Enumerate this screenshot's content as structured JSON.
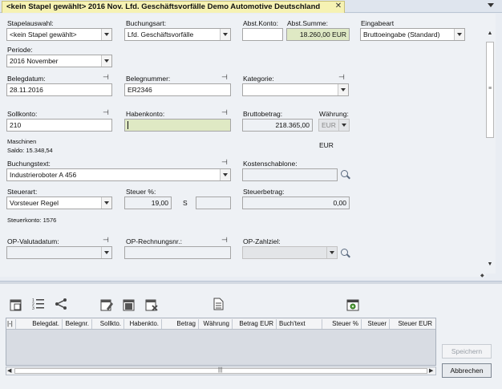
{
  "tab": {
    "title": "<kein Stapel gewählt> 2016 Nov. Lfd. Geschäftsvorfälle Demo Automotive Deutschland",
    "close": "✕"
  },
  "form": {
    "stapelauswahl": {
      "label": "Stapelauswahl:",
      "value": "<kein Stapel gewählt>"
    },
    "buchungsart": {
      "label": "Buchungsart:",
      "value": "Lfd. Geschäftsvorfälle"
    },
    "abst_konto": {
      "label": "Abst.Konto:",
      "value": ""
    },
    "abst_summe": {
      "label": "Abst.Summe:",
      "value": "18.260,00 EUR"
    },
    "eingabeart": {
      "label": "Eingabeart",
      "value": "Bruttoeingabe (Standard)"
    },
    "periode": {
      "label": "Periode:",
      "value": "2016  November"
    },
    "belegdatum": {
      "label": "Belegdatum:",
      "value": "28.11.2016"
    },
    "belegnummer": {
      "label": "Belegnummer:",
      "value": "ER2346"
    },
    "kategorie": {
      "label": "Kategorie:",
      "value": ""
    },
    "sollkonto": {
      "label": "Sollkonto:",
      "value": "210"
    },
    "habenkonto": {
      "label": "Habenkonto:",
      "value": ""
    },
    "bruttobetrag": {
      "label": "Bruttobetrag:",
      "value": "218.365,00"
    },
    "waehrung": {
      "label": "Währung:",
      "value": "EUR",
      "currency_text": "EUR"
    },
    "soll_info": {
      "name": "Maschinen",
      "saldo": "Saldo: 15.348,54"
    },
    "buchungstext": {
      "label": "Buchungstext:",
      "value": "Industrieroboter A 456"
    },
    "kostenschablone": {
      "label": "Kostenschablone:",
      "value": ""
    },
    "steuerart": {
      "label": "Steuerart:",
      "value": "Vorsteuer Regel"
    },
    "steuer_pct": {
      "label": "Steuer %:",
      "value": "19,00",
      "s_label": "S",
      "s_value": ""
    },
    "steuerbetrag": {
      "label": "Steuerbetrag:",
      "value": "0,00"
    },
    "steuerkonto": "Steuerkonto: 1576",
    "op_valutadatum": {
      "label": "OP-Valutadatum:",
      "value": ""
    },
    "op_rechnungsnr": {
      "label": "OP-Rechnungsnr.:",
      "value": ""
    },
    "op_zahlziel": {
      "label": "OP-Zahlziel:",
      "value": ""
    }
  },
  "pin_glyph": "⊣",
  "grid": {
    "columns": [
      "|-|",
      "Belegdat.",
      "Belegnr.",
      "Sollkto.",
      "Habenkto.",
      "Betrag",
      "Währung",
      "Betrag EUR",
      "Buch'text",
      "Steuer %",
      "Steuer",
      "Steuer EUR"
    ]
  },
  "buttons": {
    "save": "Speichern",
    "cancel": "Abbrechen"
  },
  "scroll": {
    "up": "▲",
    "down": "▼",
    "left": "◀",
    "right": "▶",
    "grip": "≡",
    "hgrip": "|||",
    "corner": "◆"
  },
  "colors": {
    "tab_bg": "#f6f2b3",
    "highlight_field": "#dfe9c4"
  }
}
